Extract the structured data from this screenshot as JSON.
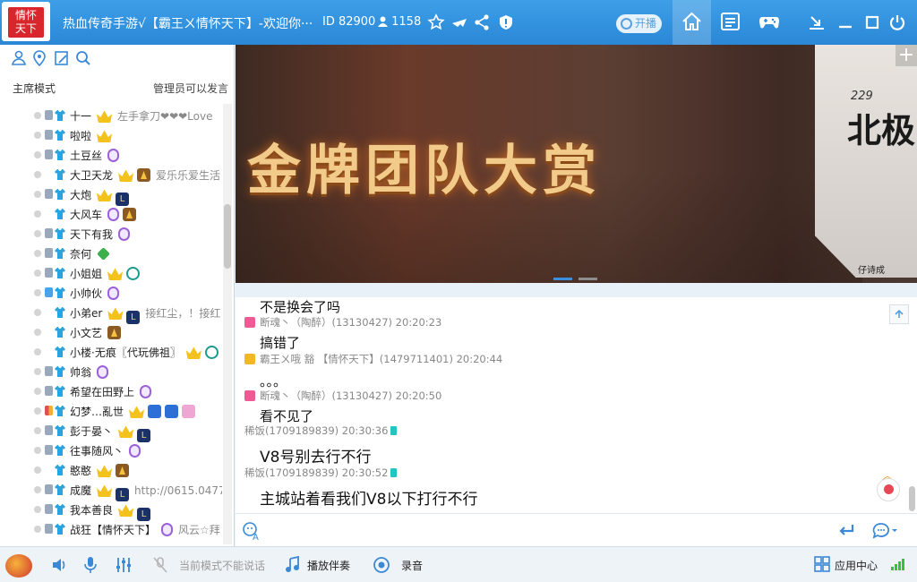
{
  "titlebar": {
    "logo_text_1": "情怀",
    "logo_text_2": "天下",
    "title": "热血传奇手游√【霸王ㄨ情怀天下】-欢迎你···",
    "room_id": "ID 82900",
    "fans": "1158",
    "onair_label": "开播",
    "accent": "#2a87d6"
  },
  "left_panel": {
    "mode_label": "主席模式",
    "mode_note": "管理员可以发言",
    "users": [
      {
        "name": "十一",
        "badges": [
          "crown"
        ],
        "sig": "左手拿刀❤❤❤Love",
        "pic": "gray"
      },
      {
        "name": "啦啦",
        "badges": [
          "crown"
        ],
        "sig": "",
        "pic": "gray"
      },
      {
        "name": "土豆丝",
        "badges": [
          "pill"
        ],
        "sig": "",
        "pic": "gray"
      },
      {
        "name": "大卫天龙",
        "badges": [
          "crown",
          "flame"
        ],
        "sig": "爱乐乐爱生活",
        "pic": "none"
      },
      {
        "name": "大炮",
        "badges": [
          "crown",
          "lsq"
        ],
        "sig": "",
        "pic": "gray"
      },
      {
        "name": "大风车",
        "badges": [
          "pill",
          "flame"
        ],
        "sig": "",
        "pic": "none"
      },
      {
        "name": "天下有我",
        "badges": [
          "pill"
        ],
        "sig": "",
        "pic": "gray"
      },
      {
        "name": "奈何",
        "badges": [
          "diam"
        ],
        "sig": "",
        "pic": "gray"
      },
      {
        "name": "小姐姐",
        "badges": [
          "crown",
          "ring"
        ],
        "sig": "",
        "pic": "gray"
      },
      {
        "name": "小帅伙",
        "badges": [
          "pill"
        ],
        "sig": "",
        "pic": "blue"
      },
      {
        "name": "小弟er",
        "badges": [
          "crown",
          "lsq"
        ],
        "sig": "接红尘，！接红",
        "pic": "none"
      },
      {
        "name": "小文艺",
        "badges": [
          "flame"
        ],
        "sig": "",
        "pic": "none"
      },
      {
        "name": "小楼·无痕〖代玩佛祖〗",
        "badges": [
          "crown",
          "ring"
        ],
        "sig": "",
        "pic": "none"
      },
      {
        "name": "帅翁",
        "badges": [
          "pill"
        ],
        "sig": "",
        "pic": "gray"
      },
      {
        "name": "希望在田野上",
        "badges": [
          "pill"
        ],
        "sig": "",
        "pic": "gray"
      },
      {
        "name": "幻梦…亂世",
        "badges": [
          "crown",
          "sq-blue",
          "sq-blue",
          "sq-pink"
        ],
        "sig": "",
        "pic": "mixed"
      },
      {
        "name": "彭于晏丶",
        "badges": [
          "crown",
          "lsq"
        ],
        "sig": "",
        "pic": "gray"
      },
      {
        "name": "往事随风丶",
        "badges": [
          "pill"
        ],
        "sig": "",
        "pic": "gray"
      },
      {
        "name": "憨憨",
        "badges": [
          "crown",
          "flame"
        ],
        "sig": "",
        "pic": "none"
      },
      {
        "name": "成魔",
        "badges": [
          "crown",
          "lsq"
        ],
        "sig": "http://0615.0477",
        "pic": "gray"
      },
      {
        "name": "我本善良",
        "badges": [
          "crown",
          "lsq"
        ],
        "sig": "",
        "pic": "gray"
      },
      {
        "name": "战狂【情怀天下】",
        "badges": [
          "pill"
        ],
        "sig": "风云☆拜",
        "pic": "gray"
      }
    ]
  },
  "banner": {
    "title": "金牌团队大赏",
    "side_number": "229",
    "side_big": "北极",
    "side_small": "仔诗成",
    "slides": 2,
    "active_slide": 0
  },
  "chat": {
    "messages": [
      {
        "text": "不是换会了吗",
        "big": false
      },
      {
        "meta": "断魂丶（陶醉）(13130427) 20:20:23",
        "gift": "pink",
        "device": false
      },
      {
        "text": "搞错了",
        "big": false
      },
      {
        "meta": "霸王ㄨ哦 豁 【情怀天下】(1479711401) 20:20:44",
        "gift": "gold",
        "device": false
      },
      {
        "text": "。。。",
        "big": false
      },
      {
        "meta": "断魂丶（陶醉）(13130427) 20:20:50",
        "gift": "pink",
        "device": false
      },
      {
        "text": "看不见了",
        "big": false
      },
      {
        "meta": "稀饭(1709189839) 20:30:36",
        "gift": "",
        "device": true
      },
      {
        "text": "V8号别去行不行",
        "big": true
      },
      {
        "meta": "稀饭(1709189839) 20:30:52",
        "gift": "",
        "device": true
      },
      {
        "text": "主城站着看我们V8以下打行不行",
        "big": true
      }
    ]
  },
  "bottom": {
    "mode_note": "当前模式不能说话",
    "music_label": "播放伴奏",
    "record_label": "录音",
    "app_center_label": "应用中心"
  }
}
